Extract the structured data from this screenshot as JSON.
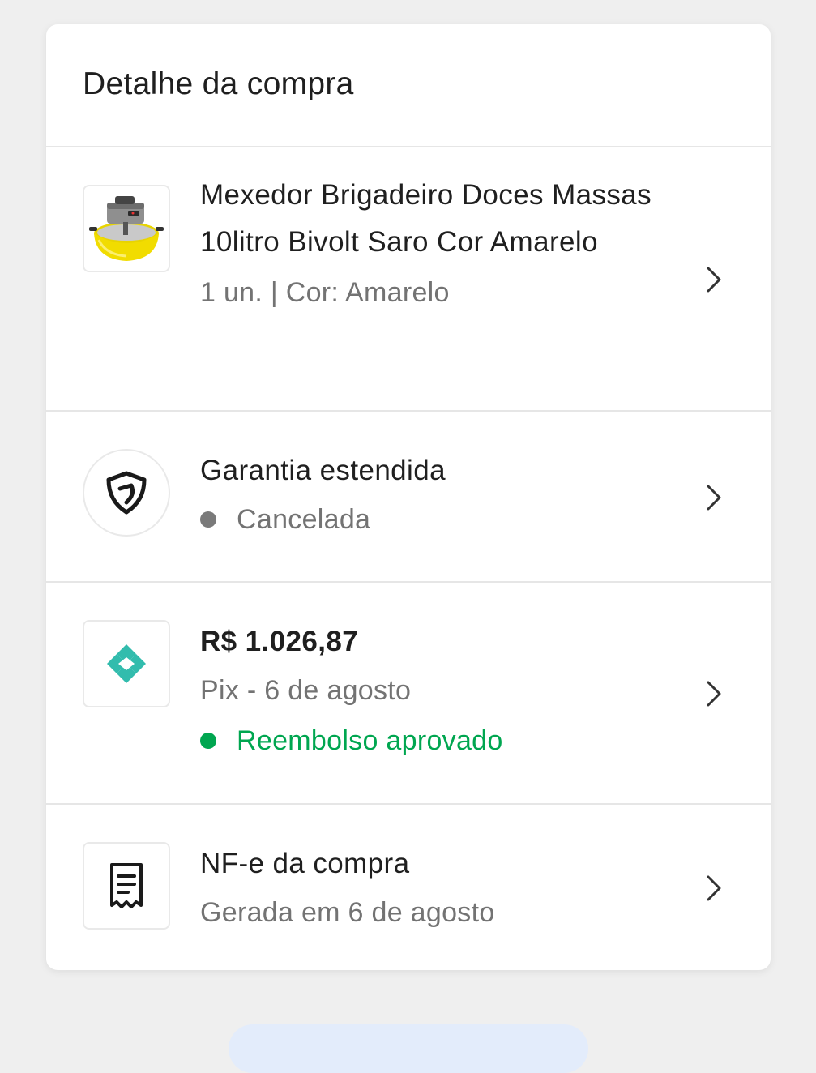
{
  "header": {
    "title": "Detalhe da compra"
  },
  "product": {
    "name": "Mexedor Brigadeiro Doces Massas 10litro Bivolt Saro Cor Amarelo",
    "details": "1 un. | Cor: Amarelo"
  },
  "warranty": {
    "title": "Garantia estendida",
    "status": "Cancelada"
  },
  "payment": {
    "amount": "R$ 1.026,87",
    "method": "Pix - 6 de agosto",
    "status": "Reembolso aprovado"
  },
  "invoice": {
    "title": "NF-e da compra",
    "subtitle": "Gerada em 6 de agosto"
  },
  "colors": {
    "status_gray": "#7a7a7a",
    "status_green": "#00a650",
    "pix_teal": "#32bcad",
    "text_primary": "#1f1f1f",
    "text_secondary": "#737373"
  },
  "icons": {
    "product": "yellow-mixer-product-image",
    "warranty": "shield-icon",
    "payment": "pix-icon",
    "invoice": "receipt-icon",
    "row_action": "chevron-right-icon"
  }
}
